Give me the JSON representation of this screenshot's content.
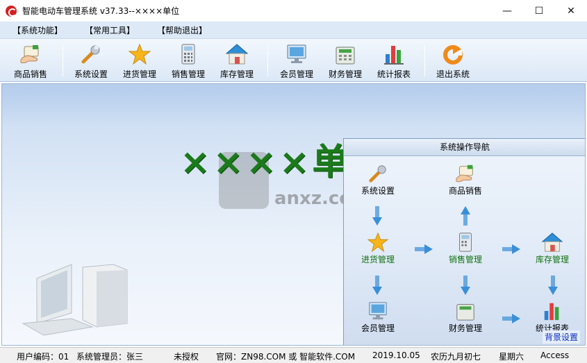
{
  "window": {
    "title": "智能电动车管理系统 v37.33--××××单位",
    "minimize_glyph": "—",
    "maximize_glyph": "☐",
    "close_glyph": "✕"
  },
  "menu": [
    "【系统功能】",
    "【常用工具】",
    "【帮助退出】"
  ],
  "toolbar": [
    {
      "label": "商品销售",
      "icon": "hand-card-icon"
    },
    {
      "label": "系统设置",
      "icon": "wrench-icon"
    },
    {
      "label": "进货管理",
      "icon": "star-icon"
    },
    {
      "label": "销售管理",
      "icon": "calculator-icon"
    },
    {
      "label": "库存管理",
      "icon": "house-icon"
    },
    {
      "label": "会员管理",
      "icon": "monitor-icon"
    },
    {
      "label": "财务管理",
      "icon": "cash-register-icon"
    },
    {
      "label": "统计报表",
      "icon": "bar-chart-icon"
    },
    {
      "label": "退出系统",
      "icon": "exit-icon"
    }
  ],
  "main": {
    "big_title": "××××单位",
    "watermark": "anxz.com"
  },
  "nav": {
    "title": "系统操作导航",
    "nodes": {
      "settings": "系统设置",
      "sales": "商品销售",
      "purchase": "进货管理",
      "sales_mgmt": "销售管理",
      "inventory": "库存管理",
      "member": "会员管理",
      "finance": "财务管理",
      "report": "统计报表"
    },
    "bg_setting": "背景设置"
  },
  "status": {
    "user_code": "用户编码：01",
    "admin": "系统管理员：张三",
    "license": "未授权",
    "website": "官网：ZN98.COM 或 智能软件.COM",
    "date": "2019.10.05",
    "lunar": "农历九月初七",
    "weekday": "星期六",
    "db": "Access"
  },
  "colors": {
    "accent_green": "#1b7a1b",
    "menubar": "#dde9f6",
    "link_blue": "#0a2fbf"
  }
}
